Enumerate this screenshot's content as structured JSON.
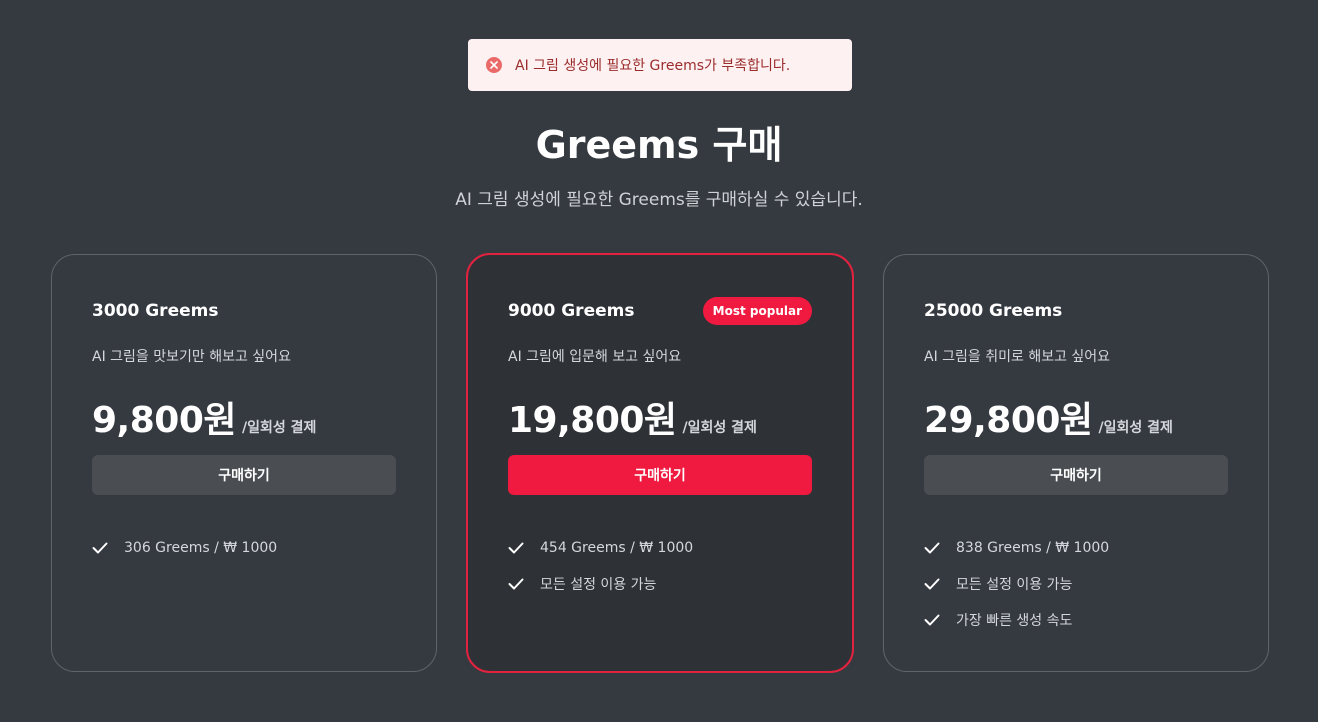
{
  "toast": {
    "message": "AI 그림 생성에 필요한 Greems가 부족합니다."
  },
  "header": {
    "title": "Greems 구매",
    "subtitle": "AI 그림 생성에 필요한 Greems를 구매하실 수 있습니다."
  },
  "plans": [
    {
      "name": "3000 Greems",
      "description": "AI 그림을 맛보기만 해보고 싶어요",
      "price": "9,800원",
      "price_suffix": "/일회성 결제",
      "button_label": "구매하기",
      "features": [
        "306 Greems / ₩ 1000"
      ]
    },
    {
      "name": "9000 Greems",
      "badge": "Most popular",
      "description": "AI 그림에 입문해 보고 싶어요",
      "price": "19,800원",
      "price_suffix": "/일회성 결제",
      "button_label": "구매하기",
      "features": [
        "454 Greems / ₩ 1000",
        "모든 설정 이용 가능"
      ]
    },
    {
      "name": "25000 Greems",
      "description": "AI 그림을 취미로 해보고 싶어요",
      "price": "29,800원",
      "price_suffix": "/일회성 결제",
      "button_label": "구매하기",
      "features": [
        "838 Greems / ₩ 1000",
        "모든 설정 이용 가능",
        "가장 빠른 생성 속도"
      ]
    }
  ],
  "colors": {
    "background": "#353940",
    "accent": "#f0193f",
    "toast_background": "#fef1f1",
    "toast_text": "#9b2c2c"
  },
  "icons": {
    "toast": "error-circle-icon",
    "feature": "check-icon"
  }
}
